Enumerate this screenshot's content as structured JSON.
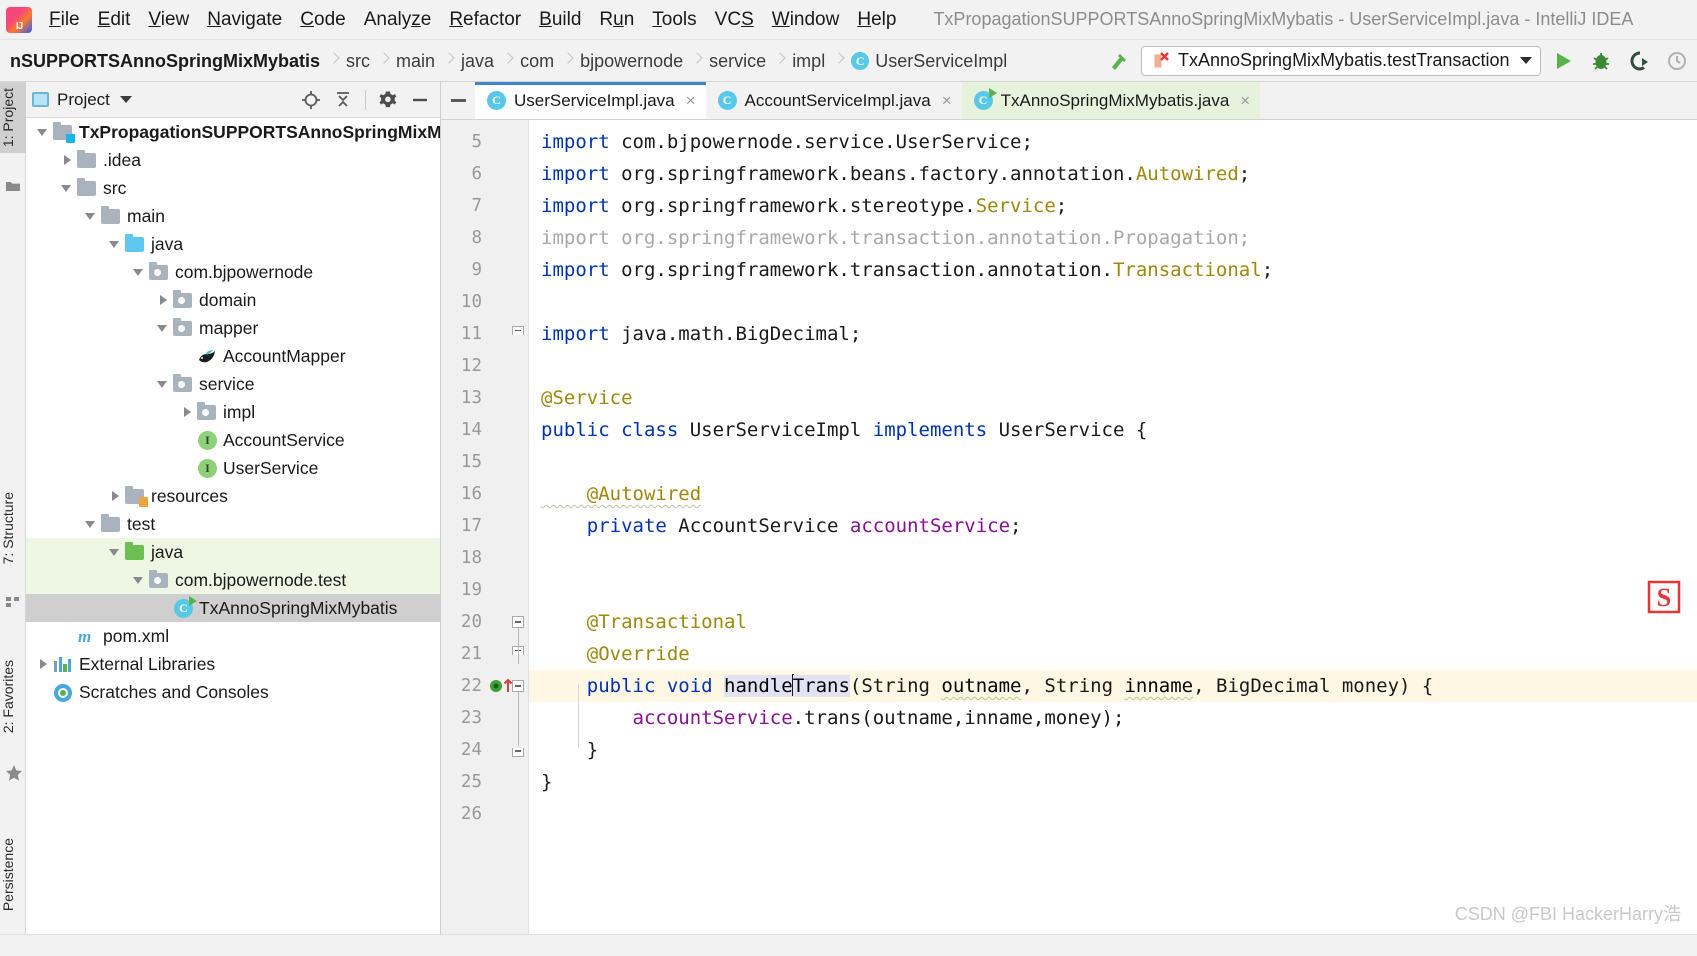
{
  "window": {
    "title": "TxPropagationSUPPORTSAnnoSpringMixMybatis - UserServiceImpl.java - IntelliJ IDEA",
    "logo_text": "IJ"
  },
  "menubar": {
    "items": [
      {
        "label": "File",
        "mnemonic": "F"
      },
      {
        "label": "Edit",
        "mnemonic": "E"
      },
      {
        "label": "View",
        "mnemonic": "V"
      },
      {
        "label": "Navigate",
        "mnemonic": "N"
      },
      {
        "label": "Code",
        "mnemonic": "C"
      },
      {
        "label": "Analyze",
        "mnemonic": "z"
      },
      {
        "label": "Refactor",
        "mnemonic": "R"
      },
      {
        "label": "Build",
        "mnemonic": "B"
      },
      {
        "label": "Run",
        "mnemonic": "u"
      },
      {
        "label": "Tools",
        "mnemonic": "T"
      },
      {
        "label": "VCS",
        "mnemonic": "S"
      },
      {
        "label": "Window",
        "mnemonic": "W"
      },
      {
        "label": "Help",
        "mnemonic": "H"
      }
    ]
  },
  "breadcrumb": {
    "items": [
      {
        "label": "nSUPPORTSAnnoSpringMixMybatis",
        "type": "module",
        "truncated": true
      },
      {
        "label": "src",
        "type": "folder"
      },
      {
        "label": "main",
        "type": "folder"
      },
      {
        "label": "java",
        "type": "folder"
      },
      {
        "label": "com",
        "type": "package"
      },
      {
        "label": "bjpowernode",
        "type": "package"
      },
      {
        "label": "service",
        "type": "package"
      },
      {
        "label": "impl",
        "type": "package"
      },
      {
        "label": "UserServiceImpl",
        "type": "class",
        "badge": "C"
      }
    ]
  },
  "toolbar": {
    "build_icon": "hammer-icon",
    "run_config": "TxAnnoSpringMixMybatis.testTransaction",
    "run_config_icon": "junit-failed-icon",
    "run_button": "run-icon",
    "debug_button": "debug-icon",
    "coverage_button": "run-with-coverage-icon",
    "profile_button": "profile-icon"
  },
  "tool_stripe": {
    "tabs": [
      {
        "label": "1: Project",
        "icon": "project-folder-icon",
        "active": true
      },
      {
        "label": "7: Structure",
        "icon": "structure-icon",
        "active": false
      },
      {
        "label": "2: Favorites",
        "icon": "star-icon",
        "active": false
      },
      {
        "label": "Persistence",
        "icon": "persistence-icon",
        "active": false
      }
    ]
  },
  "project_panel": {
    "title": "Project",
    "actions": [
      "locate-icon",
      "collapse-all-icon",
      "settings-gear-icon",
      "hide-icon"
    ],
    "tree": [
      {
        "label": "TxPropagationSUPPORTSAnnoSpringMixM",
        "depth": 0,
        "twisty": "open",
        "icon": "module-folder-icon",
        "bold": true,
        "state": "normal"
      },
      {
        "label": ".idea",
        "depth": 1,
        "twisty": "closed",
        "icon": "folder-icon",
        "bold": false,
        "state": "normal"
      },
      {
        "label": "src",
        "depth": 1,
        "twisty": "open",
        "icon": "folder-icon",
        "bold": false,
        "state": "normal"
      },
      {
        "label": "main",
        "depth": 2,
        "twisty": "open",
        "icon": "folder-icon",
        "bold": false,
        "state": "normal"
      },
      {
        "label": "java",
        "depth": 3,
        "twisty": "open",
        "icon": "source-root-icon",
        "bold": false,
        "state": "normal"
      },
      {
        "label": "com.bjpowernode",
        "depth": 4,
        "twisty": "open",
        "icon": "package-icon",
        "bold": false,
        "state": "normal"
      },
      {
        "label": "domain",
        "depth": 5,
        "twisty": "closed",
        "icon": "package-icon",
        "bold": false,
        "state": "normal"
      },
      {
        "label": "mapper",
        "depth": 5,
        "twisty": "open",
        "icon": "package-icon",
        "bold": false,
        "state": "normal"
      },
      {
        "label": "AccountMapper",
        "depth": 6,
        "twisty": "none",
        "icon": "mybatis-bird-icon",
        "bold": false,
        "state": "normal"
      },
      {
        "label": "service",
        "depth": 5,
        "twisty": "open",
        "icon": "package-icon",
        "bold": false,
        "state": "normal"
      },
      {
        "label": "impl",
        "depth": 6,
        "twisty": "closed",
        "icon": "package-icon",
        "bold": false,
        "state": "normal"
      },
      {
        "label": "AccountService",
        "depth": 6,
        "twisty": "none",
        "icon": "interface-icon",
        "bold": false,
        "state": "normal"
      },
      {
        "label": "UserService",
        "depth": 6,
        "twisty": "none",
        "icon": "interface-icon",
        "bold": false,
        "state": "normal"
      },
      {
        "label": "resources",
        "depth": 3,
        "twisty": "closed",
        "icon": "resource-root-icon",
        "bold": false,
        "state": "normal"
      },
      {
        "label": "test",
        "depth": 2,
        "twisty": "open",
        "icon": "folder-icon",
        "bold": false,
        "state": "normal"
      },
      {
        "label": "java",
        "depth": 3,
        "twisty": "open",
        "icon": "test-source-root-icon",
        "bold": false,
        "state": "green"
      },
      {
        "label": "com.bjpowernode.test",
        "depth": 4,
        "twisty": "open",
        "icon": "package-icon",
        "bold": false,
        "state": "green"
      },
      {
        "label": "TxAnnoSpringMixMybatis",
        "depth": 5,
        "twisty": "none",
        "icon": "runnable-class-icon",
        "bold": false,
        "state": "selected"
      },
      {
        "label": "pom.xml",
        "depth": 1,
        "twisty": "none",
        "icon": "maven-icon",
        "bold": false,
        "state": "normal"
      },
      {
        "label": "External Libraries",
        "depth": 0,
        "twisty": "closed",
        "icon": "libraries-icon",
        "bold": false,
        "state": "normal"
      },
      {
        "label": "Scratches and Consoles",
        "depth": 0,
        "twisty": "none",
        "icon": "scratches-icon",
        "bold": false,
        "state": "normal"
      }
    ]
  },
  "editor": {
    "tabs": [
      {
        "label": "UserServiceImpl.java",
        "icon": "class-icon",
        "active": true,
        "close": "×",
        "style": "active"
      },
      {
        "label": "AccountServiceImpl.java",
        "icon": "class-icon",
        "active": false,
        "close": "×",
        "style": "normal"
      },
      {
        "label": "TxAnnoSpringMixMybatis.java",
        "icon": "runnable-class-icon",
        "active": false,
        "close": "×",
        "style": "green"
      }
    ],
    "first_line_number": 5,
    "lines": [
      {
        "num": 5,
        "fold": "none",
        "mark": "none",
        "current": false,
        "tokens": [
          {
            "t": "import ",
            "c": "kw"
          },
          {
            "t": "com.bjpowernode.service.",
            "c": "plain"
          },
          {
            "t": "UserService",
            "c": "plain"
          },
          {
            "t": ";",
            "c": "plain"
          }
        ]
      },
      {
        "num": 6,
        "fold": "none",
        "mark": "none",
        "current": false,
        "tokens": [
          {
            "t": "import ",
            "c": "kw"
          },
          {
            "t": "org.springframework.beans.factory.annotation.",
            "c": "plain"
          },
          {
            "t": "Autowired",
            "c": "goldish"
          },
          {
            "t": ";",
            "c": "plain"
          }
        ]
      },
      {
        "num": 7,
        "fold": "none",
        "mark": "none",
        "current": false,
        "tokens": [
          {
            "t": "import ",
            "c": "kw"
          },
          {
            "t": "org.springframework.stereotype.",
            "c": "plain"
          },
          {
            "t": "Service",
            "c": "goldish"
          },
          {
            "t": ";",
            "c": "plain"
          }
        ]
      },
      {
        "num": 8,
        "fold": "none",
        "mark": "none",
        "current": false,
        "tokens": [
          {
            "t": "import org.springframework.transaction.annotation.Propagation;",
            "c": "dim"
          }
        ]
      },
      {
        "num": 9,
        "fold": "none",
        "mark": "none",
        "current": false,
        "tokens": [
          {
            "t": "import ",
            "c": "kw"
          },
          {
            "t": "org.springframework.transaction.annotation.",
            "c": "plain"
          },
          {
            "t": "Transactional",
            "c": "goldish"
          },
          {
            "t": ";",
            "c": "plain"
          }
        ]
      },
      {
        "num": 10,
        "fold": "none",
        "mark": "none",
        "current": false,
        "tokens": []
      },
      {
        "num": 11,
        "fold": "cap",
        "mark": "none",
        "current": false,
        "tokens": [
          {
            "t": "import ",
            "c": "kw"
          },
          {
            "t": "java.math.BigDecimal;",
            "c": "plain"
          }
        ]
      },
      {
        "num": 12,
        "fold": "none",
        "mark": "none",
        "current": false,
        "tokens": []
      },
      {
        "num": 13,
        "fold": "none",
        "mark": "none",
        "current": false,
        "tokens": [
          {
            "t": "@Service",
            "c": "anno"
          }
        ]
      },
      {
        "num": 14,
        "fold": "none",
        "mark": "none",
        "current": false,
        "tokens": [
          {
            "t": "public ",
            "c": "kw"
          },
          {
            "t": "class ",
            "c": "kw"
          },
          {
            "t": "UserServiceImpl ",
            "c": "cls"
          },
          {
            "t": "implements ",
            "c": "kw"
          },
          {
            "t": "UserService {",
            "c": "cls"
          }
        ]
      },
      {
        "num": 15,
        "fold": "none",
        "mark": "none",
        "current": false,
        "tokens": []
      },
      {
        "num": 16,
        "fold": "none",
        "mark": "none",
        "current": false,
        "tokens": [
          {
            "t": "    @Autowired",
            "c": "anno squig"
          }
        ]
      },
      {
        "num": 17,
        "fold": "none",
        "mark": "none",
        "current": false,
        "tokens": [
          {
            "t": "    private ",
            "c": "kw"
          },
          {
            "t": "AccountService ",
            "c": "cls"
          },
          {
            "t": "accountService",
            "c": "fld"
          },
          {
            "t": ";",
            "c": "plain"
          }
        ]
      },
      {
        "num": 18,
        "fold": "none",
        "mark": "none",
        "current": false,
        "tokens": []
      },
      {
        "num": 19,
        "fold": "none",
        "mark": "none",
        "current": false,
        "tokens": []
      },
      {
        "num": 20,
        "fold": "box",
        "mark": "none",
        "current": false,
        "tokens": [
          {
            "t": "    @Transactional",
            "c": "anno"
          }
        ]
      },
      {
        "num": 21,
        "fold": "cap",
        "mark": "none",
        "current": false,
        "tokens": [
          {
            "t": "    @Override",
            "c": "anno"
          }
        ]
      },
      {
        "num": 22,
        "fold": "box",
        "mark": "override-impl",
        "current": true,
        "tokens": [
          {
            "t": "    public ",
            "c": "kw"
          },
          {
            "t": "void ",
            "c": "kw"
          },
          {
            "t": "handle",
            "c": "sel-hl"
          },
          {
            "t": "CARET",
            "c": "caret"
          },
          {
            "t": "Trans",
            "c": "sel-hl"
          },
          {
            "t": "(",
            "c": "plain"
          },
          {
            "t": "String ",
            "c": "cls"
          },
          {
            "t": "outname",
            "c": "squig"
          },
          {
            "t": ", ",
            "c": "plain"
          },
          {
            "t": "String ",
            "c": "cls"
          },
          {
            "t": "inname",
            "c": "squig"
          },
          {
            "t": ", ",
            "c": "plain"
          },
          {
            "t": "BigDecimal ",
            "c": "cls"
          },
          {
            "t": "money",
            "c": "plain"
          },
          {
            "t": ") {",
            "c": "plain"
          }
        ]
      },
      {
        "num": 23,
        "fold": "none",
        "mark": "none",
        "current": false,
        "tokens": [
          {
            "t": "        ",
            "c": "plain"
          },
          {
            "t": "accountService",
            "c": "fld"
          },
          {
            "t": ".trans(outname,inname,money);",
            "c": "plain"
          }
        ]
      },
      {
        "num": 24,
        "fold": "bot",
        "mark": "none",
        "current": false,
        "tokens": [
          {
            "t": "    }",
            "c": "plain"
          }
        ]
      },
      {
        "num": 25,
        "fold": "none",
        "mark": "none",
        "current": false,
        "tokens": [
          {
            "t": "}",
            "c": "plain"
          }
        ]
      },
      {
        "num": 26,
        "fold": "none",
        "mark": "none",
        "current": false,
        "tokens": []
      }
    ]
  },
  "overlays": {
    "ime_logo": "sogou-ime-icon",
    "watermark": "CSDN @FBI HackerHarry浩"
  },
  "colors": {
    "accent_blue": "#3d86d0",
    "keyword": "#0033b3",
    "annotation": "#9e880d",
    "field": "#871094",
    "class_icon": "#58c8e8",
    "interface_icon": "#8ed17a",
    "test_green": "#6cc051",
    "current_line": "#fdf7e3",
    "selection": "#e2e2f5",
    "tree_selection": "#cfcfcf"
  }
}
